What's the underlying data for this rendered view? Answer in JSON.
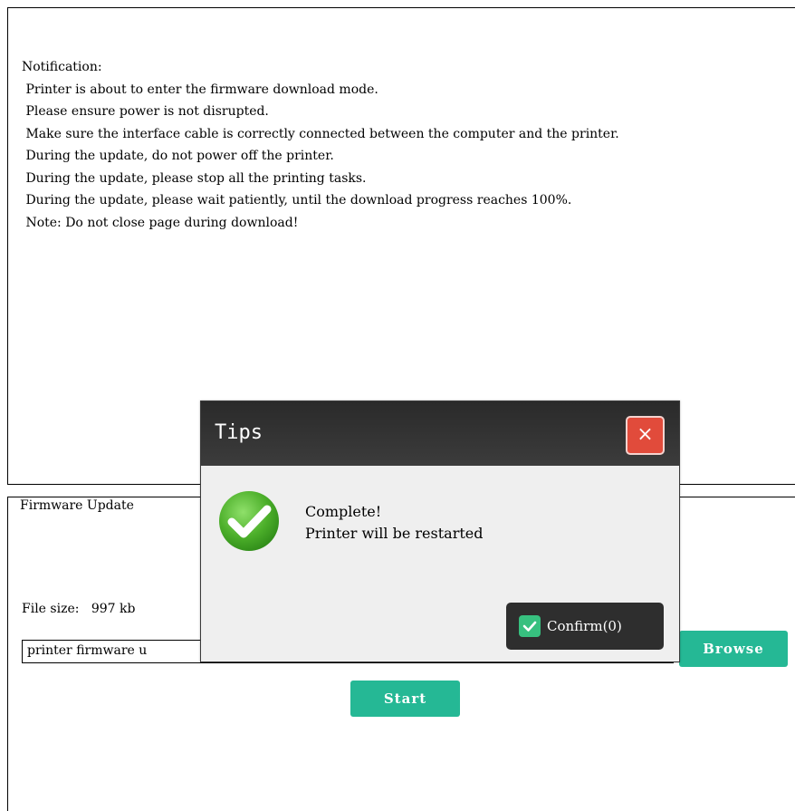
{
  "notification": {
    "text": "Notification:\n Printer is about to enter the firmware download mode.\n Please ensure power is not disrupted.\n Make sure the interface cable is correctly connected between the computer and the printer.\n During the update, do not power off the printer.\n During the update, please stop all the printing tasks.\n During the update, please wait patiently, until the download progress reaches 100%.\n Note: Do not close page during download!"
  },
  "firmware": {
    "legend": "Firmware Update",
    "file_size_label": "File size:",
    "file_size_value": "997 kb",
    "file_path": "printer firmware u",
    "browse_label": "Browse",
    "start_label": "Start"
  },
  "dialog": {
    "title": "Tips",
    "close_symbol": "×",
    "message_line1": "Complete!",
    "message_line2": "Printer will be restarted",
    "confirm_label": "Confirm(0)"
  },
  "colors": {
    "accent_green": "#25b895",
    "close_red": "#e14b3b",
    "dialog_header": "#2a2a2a"
  }
}
